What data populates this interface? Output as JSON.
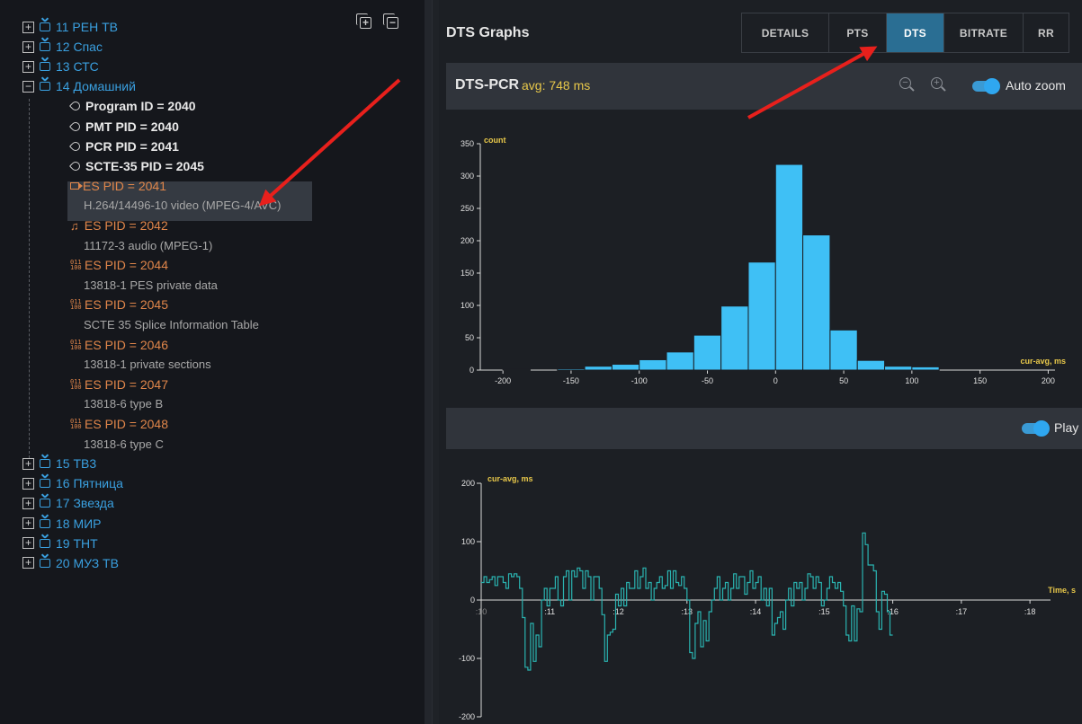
{
  "tree": {
    "programs_top": [
      {
        "label": "11 РЕН ТВ"
      },
      {
        "label": "12 Спас"
      },
      {
        "label": "13 СТС"
      }
    ],
    "expanded": {
      "label": "14 Домашний",
      "meta": [
        "Program ID = 2040",
        "PMT PID = 2040",
        "PCR PID = 2041",
        "SCTE-35 PID = 2045"
      ],
      "es": [
        {
          "icon": "video-camera-icon",
          "label": "ES PID = 2041",
          "desc": "H.264/14496-10 video (MPEG-4/AVC)"
        },
        {
          "icon": "music-note-icon",
          "label": "ES PID = 2042",
          "desc": "11172-3 audio (MPEG-1)"
        },
        {
          "icon": "binary-data-icon",
          "label": "ES PID = 2044",
          "desc": "13818-1 PES private data"
        },
        {
          "icon": "binary-data-icon",
          "label": "ES PID = 2045",
          "desc": "SCTE 35 Splice Information Table"
        },
        {
          "icon": "binary-data-icon",
          "label": "ES PID = 2046",
          "desc": "13818-1 private sections"
        },
        {
          "icon": "binary-data-icon",
          "label": "ES PID = 2047",
          "desc": "13818-6 type B"
        },
        {
          "icon": "binary-data-icon",
          "label": "ES PID = 2048",
          "desc": "13818-6 type C"
        }
      ]
    },
    "programs_bottom": [
      {
        "label": "15 ТВ3"
      },
      {
        "label": "16 Пятница"
      },
      {
        "label": "17 Звезда"
      },
      {
        "label": "18 МИР"
      },
      {
        "label": "19 ТНТ"
      },
      {
        "label": "20 МУЗ ТВ"
      }
    ]
  },
  "header": {
    "title": "DTS Graphs",
    "tabs": [
      "DETAILS",
      "PTS",
      "DTS",
      "BITRATE",
      "RR"
    ],
    "active_tab": "DTS"
  },
  "histogram_panel": {
    "title": "DTS-PCR",
    "avg": "avg: 748 ms",
    "auto_zoom_label": "Auto zoom"
  },
  "timeline_panel": {
    "play_label": "Play"
  },
  "colors": {
    "accent": "#2a6e93",
    "bar": "#3fc0f5",
    "line": "#2ab3b0",
    "axis_label": "#e8c84a",
    "program": "#3aa0e0",
    "es": "#e0864a"
  },
  "chart_data": [
    {
      "type": "bar",
      "title": "",
      "ylabel": "count",
      "xlabel": "cur-avg, ms",
      "xlim": [
        -210,
        205
      ],
      "ylim": [
        0,
        350
      ],
      "xticks": [
        -200,
        -150,
        -100,
        -50,
        0,
        50,
        100,
        150,
        200
      ],
      "yticks": [
        0,
        50,
        100,
        150,
        200,
        250,
        300,
        350
      ],
      "bin_width": 20,
      "bin_starts": [
        -200,
        -180,
        -160,
        -140,
        -120,
        -100,
        -80,
        -60,
        -40,
        -20,
        0,
        20,
        40,
        60,
        80,
        100,
        120,
        140,
        160,
        180
      ],
      "values": [
        1,
        0,
        2,
        6,
        9,
        16,
        28,
        54,
        99,
        167,
        318,
        209,
        62,
        15,
        6,
        5,
        0,
        0,
        0,
        0
      ]
    },
    {
      "type": "line",
      "title": "",
      "ylabel": "cur-avg, ms",
      "xlabel": "Time, s",
      "ylim": [
        -200,
        200
      ],
      "yticks": [
        -200,
        -100,
        0,
        100,
        200
      ],
      "xticks": [
        ":10",
        ":11",
        ":12",
        ":13",
        ":14",
        ":15",
        ":16",
        ":17",
        ":18"
      ],
      "xlim": [
        10,
        18.3
      ],
      "step": true,
      "x_start": 10,
      "x_step": 0.04,
      "values": [
        30,
        40,
        30,
        35,
        40,
        25,
        40,
        40,
        30,
        20,
        45,
        40,
        45,
        40,
        20,
        -30,
        -115,
        -120,
        -40,
        -105,
        -60,
        -80,
        0,
        20,
        -10,
        20,
        20,
        40,
        0,
        -10,
        40,
        50,
        0,
        50,
        40,
        55,
        50,
        20,
        50,
        40,
        0,
        40,
        40,
        20,
        -25,
        -105,
        -60,
        -55,
        -50,
        10,
        -10,
        20,
        -10,
        30,
        20,
        20,
        50,
        20,
        40,
        55,
        20,
        30,
        0,
        20,
        30,
        40,
        20,
        25,
        50,
        20,
        50,
        30,
        25,
        40,
        20,
        0,
        -90,
        -100,
        -40,
        -20,
        -80,
        -35,
        -70,
        -20,
        0,
        20,
        40,
        0,
        20,
        30,
        0,
        20,
        45,
        20,
        40,
        40,
        10,
        30,
        50,
        20,
        30,
        40,
        0,
        20,
        -10,
        20,
        -60,
        -40,
        -30,
        -20,
        -50,
        0,
        20,
        -10,
        30,
        20,
        30,
        0,
        20,
        45,
        40,
        20,
        40,
        30,
        -10,
        0,
        20,
        40,
        30,
        20,
        30,
        15,
        -10,
        -60,
        -70,
        -10,
        -70,
        -15,
        -20,
        115,
        95,
        60,
        60,
        50,
        -20,
        -50,
        15,
        10,
        -20,
        -60
      ]
    }
  ]
}
